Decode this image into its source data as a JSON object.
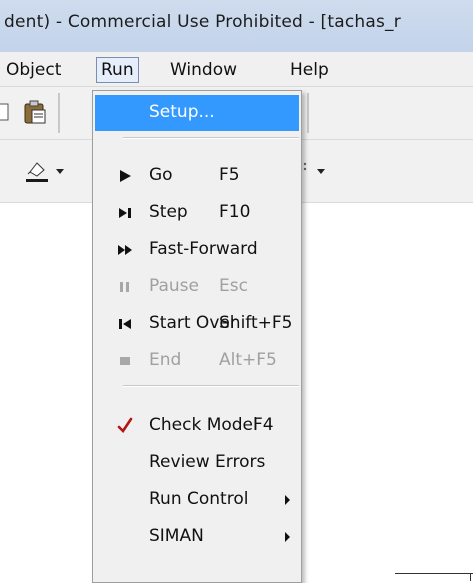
{
  "window": {
    "title": "dent) - Commercial Use Prohibited - [tachas_r"
  },
  "menubar": {
    "items": [
      {
        "label": "Object"
      },
      {
        "label": "Run"
      },
      {
        "label": "Window"
      },
      {
        "label": "Help"
      }
    ]
  },
  "run_menu": {
    "setup": {
      "label": "Setup..."
    },
    "go": {
      "label": "Go",
      "shortcut": "F5",
      "icon": "play-icon"
    },
    "step": {
      "label": "Step",
      "shortcut": "F10",
      "icon": "step-icon"
    },
    "fast_forward": {
      "label": "Fast-Forward",
      "icon": "fast-forward-icon"
    },
    "pause": {
      "label": "Pause",
      "shortcut": "Esc",
      "icon": "pause-icon",
      "disabled": true
    },
    "start_over": {
      "label": "Start Over",
      "shortcut": "Shift+F5",
      "icon": "start-over-icon"
    },
    "end": {
      "label": "End",
      "shortcut": "Alt+F5",
      "icon": "stop-icon",
      "disabled": true
    },
    "check_model": {
      "label": "Check Model",
      "shortcut": "F4",
      "icon": "check-icon"
    },
    "review_errors": {
      "label": "Review Errors"
    },
    "run_control": {
      "label": "Run Control",
      "has_submenu": true
    },
    "siman": {
      "label": "SIMAN",
      "has_submenu": true
    }
  },
  "colors": {
    "highlight": "#3399ff",
    "check_mark": "#b01818"
  }
}
